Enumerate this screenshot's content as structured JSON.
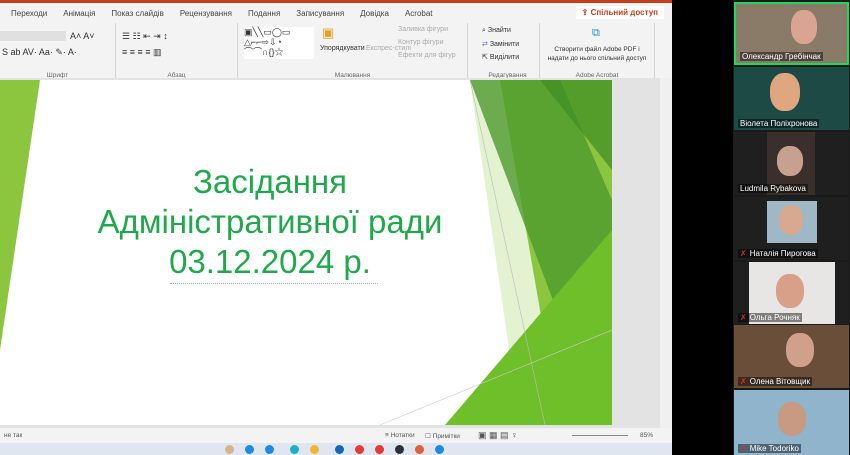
{
  "ribbon": {
    "tabs": [
      "Переходи",
      "Анімація",
      "Показ слайдів",
      "Рецензування",
      "Подання",
      "Записування",
      "Довідка",
      "Acrobat"
    ],
    "share": "Спільний доступ",
    "groups": {
      "font": "Шрифт",
      "paragraph": "Абзац",
      "drawing": "Малювання",
      "editing": "Редагування",
      "acrobat": "Adobe Acrobat"
    },
    "drawing": {
      "arrange": "Упорядкувати",
      "quick_styles": "Експрес-стилі",
      "fill": "Заливка фігури",
      "outline": "Контур фігури",
      "effects": "Ефекти для фігур"
    },
    "editing": {
      "find": "Знайти",
      "replace": "Замінити",
      "select": "Виділити"
    },
    "acrobat": {
      "create": "Створити файл Adobe PDF і",
      "share": "надати до нього спільний доступ"
    }
  },
  "slide": {
    "title_lines": [
      "Засідання",
      "Адміністративної ради",
      "03.12.2024 р."
    ]
  },
  "status": {
    "left": "не так",
    "notes": "Нотатки",
    "comments": "Примітки",
    "zoom": "85%"
  },
  "participants": [
    {
      "name": "Олександр Гребінчак",
      "muted": false,
      "active": true
    },
    {
      "name": "Віолета Поліхронова",
      "muted": false,
      "active": false
    },
    {
      "name": "Ludmila Rybakova",
      "muted": false,
      "active": false
    },
    {
      "name": "Наталія Пирогова",
      "muted": true,
      "active": false
    },
    {
      "name": "Ольга Рочняк",
      "muted": true,
      "active": false
    },
    {
      "name": "Олена Вітовщик",
      "muted": true,
      "active": false
    },
    {
      "name": "Mike Todoriko",
      "muted": true,
      "active": false
    }
  ],
  "colors": {
    "accent": "#c43e1c",
    "slide_green": "#1fa94a",
    "speaker_border": "#1ed760"
  }
}
